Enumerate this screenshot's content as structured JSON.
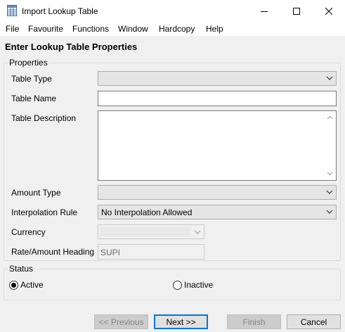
{
  "window": {
    "title": "Import Lookup Table",
    "icon": "table-icon"
  },
  "menu": [
    "File",
    "Favourite",
    "Functions",
    "Window",
    "Hardcopy",
    "Help"
  ],
  "header": {
    "title": "Enter Lookup Table Properties"
  },
  "properties": {
    "group_label": "Properties",
    "table_type": {
      "label": "Table Type",
      "value": ""
    },
    "table_name": {
      "label": "Table Name",
      "value": ""
    },
    "table_description": {
      "label": "Table Description",
      "value": ""
    },
    "amount_type": {
      "label": "Amount Type",
      "value": ""
    },
    "interpolation_rule": {
      "label": "Interpolation Rule",
      "value": "No Interpolation Allowed"
    },
    "currency": {
      "label": "Currency",
      "value": ""
    },
    "rate_amount_heading": {
      "label": "Rate/Amount Heading",
      "value": "SUPI"
    }
  },
  "status": {
    "group_label": "Status",
    "active": {
      "label": "Active",
      "checked": true
    },
    "inactive": {
      "label": "Inactive",
      "checked": false
    }
  },
  "buttons": {
    "previous": "<< Previous",
    "next": "Next >>",
    "finish": "Finish",
    "cancel": "Cancel"
  }
}
